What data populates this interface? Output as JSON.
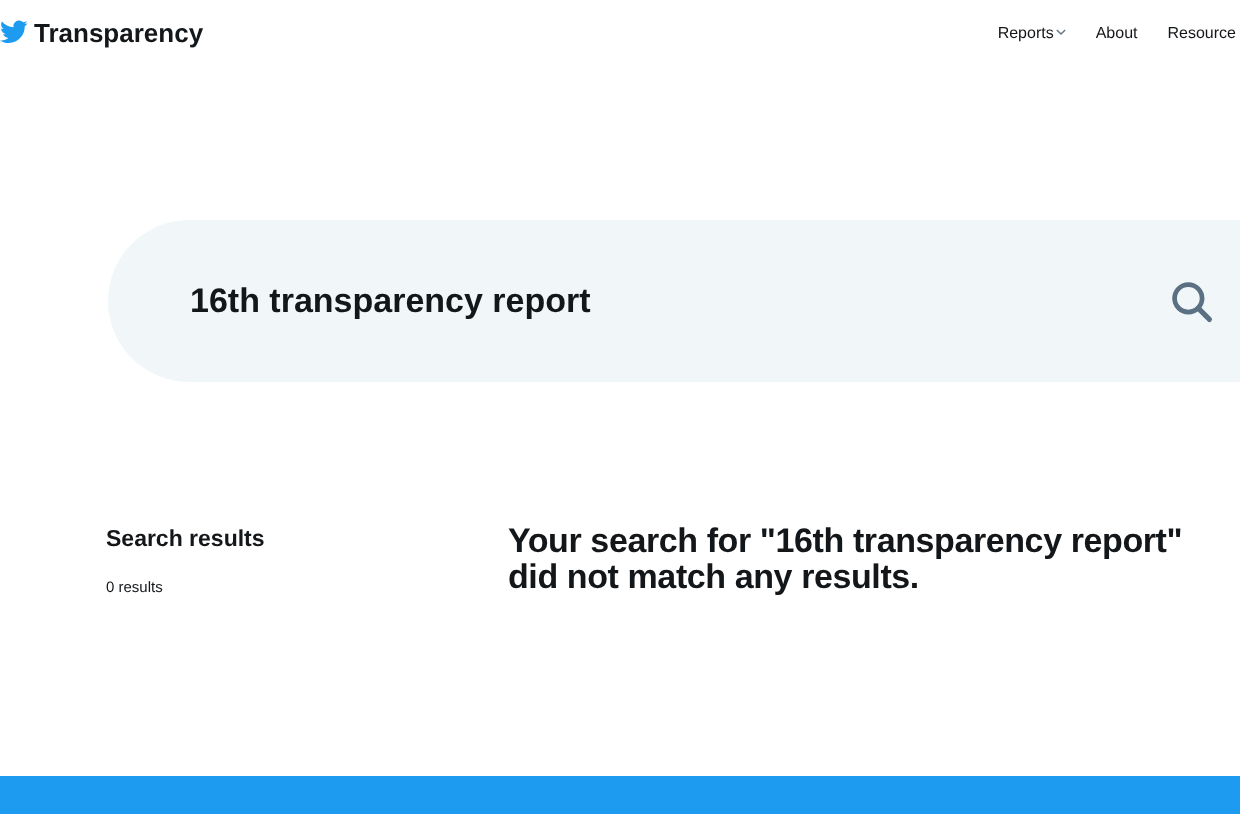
{
  "header": {
    "brand": "Transparency",
    "nav": [
      {
        "label": "Reports",
        "has_menu": true
      },
      {
        "label": "About",
        "has_menu": false
      },
      {
        "label": "Resource",
        "has_menu": false
      }
    ]
  },
  "search": {
    "value": "16th transparency report"
  },
  "results": {
    "heading": "Search results",
    "count": "0 results",
    "message": "Your search for \"16th transparency report\" did not match any results."
  }
}
